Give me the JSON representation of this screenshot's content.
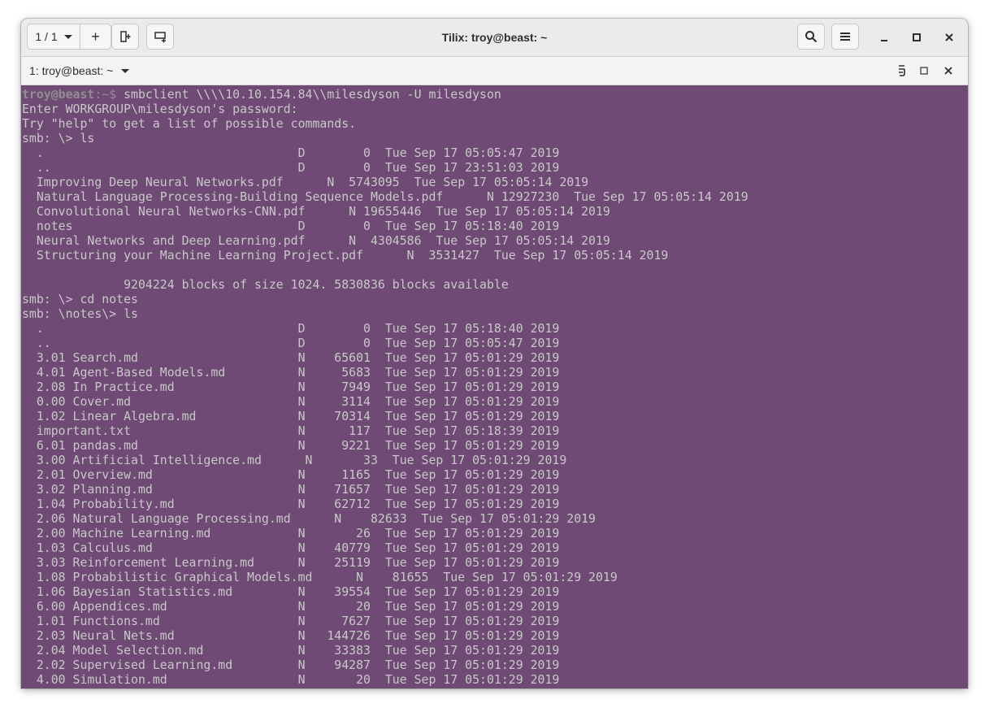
{
  "headerbar": {
    "session_label": "1 / 1",
    "add_label": "+",
    "title": "Tilix: troy@beast: ~"
  },
  "tab": {
    "title": "1: troy@beast: ~"
  },
  "colors": {
    "terminal_bg": "#6f4a75",
    "terminal_fg": "#c8c8c8",
    "headerbar_bg": "#ebebeb"
  },
  "icons": [
    "session-dropdown-icon",
    "add-terminal-icon",
    "split-right-icon",
    "split-down-icon",
    "search-icon",
    "hamburger-menu-icon",
    "minimize-icon",
    "maximize-icon",
    "close-icon",
    "tab-dropdown-icon",
    "read-only-icon",
    "maximize-terminal-icon",
    "close-terminal-icon"
  ],
  "terminal": {
    "prompt_user": "troy@beast",
    "prompt_path": ":~$",
    "command": " smbclient \\\\\\\\10.10.154.84\\\\milesdyson -U milesdyson",
    "lines": [
      "Enter WORKGROUP\\milesdyson's password:",
      "Try \"help\" to get a list of possible commands.",
      "smb: \\> ls",
      "  .                                   D        0  Tue Sep 17 05:05:47 2019",
      "  ..                                  D        0  Tue Sep 17 23:51:03 2019",
      "  Improving Deep Neural Networks.pdf      N  5743095  Tue Sep 17 05:05:14 2019",
      "  Natural Language Processing-Building Sequence Models.pdf      N 12927230  Tue Sep 17 05:05:14 2019",
      "  Convolutional Neural Networks-CNN.pdf      N 19655446  Tue Sep 17 05:05:14 2019",
      "  notes                               D        0  Tue Sep 17 05:18:40 2019",
      "  Neural Networks and Deep Learning.pdf      N  4304586  Tue Sep 17 05:05:14 2019",
      "  Structuring your Machine Learning Project.pdf      N  3531427  Tue Sep 17 05:05:14 2019",
      "",
      "              9204224 blocks of size 1024. 5830836 blocks available",
      "smb: \\> cd notes",
      "smb: \\notes\\> ls",
      "  .                                   D        0  Tue Sep 17 05:18:40 2019",
      "  ..                                  D        0  Tue Sep 17 05:05:47 2019",
      "  3.01 Search.md                      N    65601  Tue Sep 17 05:01:29 2019",
      "  4.01 Agent-Based Models.md          N     5683  Tue Sep 17 05:01:29 2019",
      "  2.08 In Practice.md                 N     7949  Tue Sep 17 05:01:29 2019",
      "  0.00 Cover.md                       N     3114  Tue Sep 17 05:01:29 2019",
      "  1.02 Linear Algebra.md              N    70314  Tue Sep 17 05:01:29 2019",
      "  important.txt                       N      117  Tue Sep 17 05:18:39 2019",
      "  6.01 pandas.md                      N     9221  Tue Sep 17 05:01:29 2019",
      "  3.00 Artificial Intelligence.md      N       33  Tue Sep 17 05:01:29 2019",
      "  2.01 Overview.md                    N     1165  Tue Sep 17 05:01:29 2019",
      "  3.02 Planning.md                    N    71657  Tue Sep 17 05:01:29 2019",
      "  1.04 Probability.md                 N    62712  Tue Sep 17 05:01:29 2019",
      "  2.06 Natural Language Processing.md      N    82633  Tue Sep 17 05:01:29 2019",
      "  2.00 Machine Learning.md            N       26  Tue Sep 17 05:01:29 2019",
      "  1.03 Calculus.md                    N    40779  Tue Sep 17 05:01:29 2019",
      "  3.03 Reinforcement Learning.md      N    25119  Tue Sep 17 05:01:29 2019",
      "  1.08 Probabilistic Graphical Models.md      N    81655  Tue Sep 17 05:01:29 2019",
      "  1.06 Bayesian Statistics.md         N    39554  Tue Sep 17 05:01:29 2019",
      "  6.00 Appendices.md                  N       20  Tue Sep 17 05:01:29 2019",
      "  1.01 Functions.md                   N     7627  Tue Sep 17 05:01:29 2019",
      "  2.03 Neural Nets.md                 N   144726  Tue Sep 17 05:01:29 2019",
      "  2.04 Model Selection.md             N    33383  Tue Sep 17 05:01:29 2019",
      "  2.02 Supervised Learning.md         N    94287  Tue Sep 17 05:01:29 2019",
      "  4.00 Simulation.md                  N       20  Tue Sep 17 05:01:29 2019"
    ]
  }
}
